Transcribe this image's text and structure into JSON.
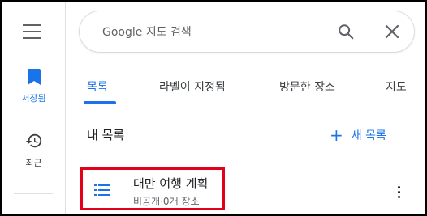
{
  "sidebar": {
    "menu_icon": "hamburger-menu-icon",
    "items": [
      {
        "label": "저장됨",
        "icon": "bookmark-icon",
        "color": "#1a73e8",
        "active": true
      },
      {
        "label": "최근",
        "icon": "history-icon",
        "color": "#3c4043",
        "active": false
      }
    ]
  },
  "search": {
    "placeholder": "Google 지도 검색",
    "value": ""
  },
  "tabs": [
    {
      "label": "목록",
      "active": true
    },
    {
      "label": "라벨이 지정됨",
      "active": false
    },
    {
      "label": "방문한 장소",
      "active": false
    },
    {
      "label": "지도",
      "active": false
    }
  ],
  "lists_section": {
    "title": "내 목록",
    "new_list_label": "새 목록",
    "items": [
      {
        "name": "대만 여행 계획",
        "meta": "비공개·0개 장소",
        "icon": "list-icon"
      }
    ]
  },
  "colors": {
    "accent": "#1a73e8",
    "highlight": "#e3001b"
  }
}
